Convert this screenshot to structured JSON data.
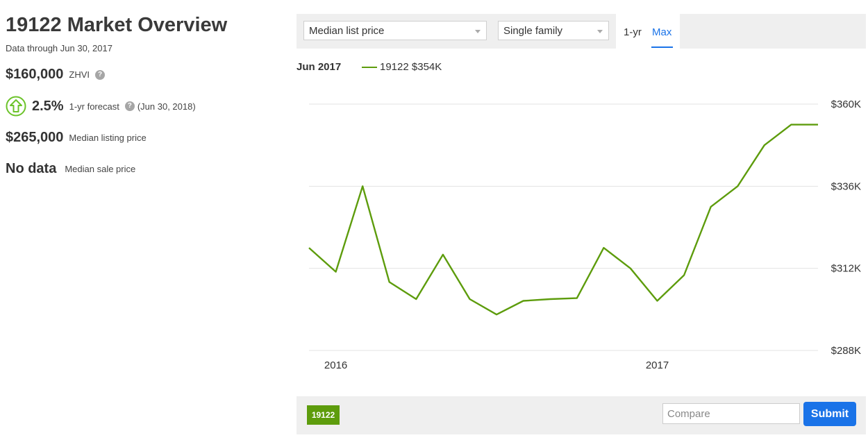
{
  "overview": {
    "title": "19122 Market Overview",
    "data_through": "Data through Jun 30, 2017",
    "zhvi_value": "$160,000",
    "zhvi_label": "ZHVI",
    "help_glyph": "?",
    "forecast_value": "2.5%",
    "forecast_label": "1-yr forecast",
    "forecast_date": "(Jun 30, 2018)",
    "listing_value": "$265,000",
    "listing_label": "Median listing price",
    "sale_value": "No data",
    "sale_label": "Median sale price"
  },
  "toolbar": {
    "metric_select": "Median list price",
    "home_type_select": "Single family",
    "range_1yr": "1-yr",
    "range_max": "Max",
    "active_range": "Max"
  },
  "legend": {
    "date": "Jun 2017",
    "series_label": "19122 $354K"
  },
  "colors": {
    "series": "#5d9c0c",
    "accent": "#1a73e8",
    "forecast_up": "#6cc32a"
  },
  "icons": {
    "help": "question-circle-icon",
    "forecast": "arrow-up-circle-icon",
    "dropdown": "caret-down-icon"
  },
  "bottom": {
    "region_tag": "19122",
    "compare_placeholder": "Compare",
    "submit_label": "Submit"
  },
  "chart_data": {
    "type": "line",
    "x": [
      "2015-09",
      "2015-10",
      "2015-11",
      "2015-12",
      "2016-01",
      "2016-02",
      "2016-03",
      "2016-04",
      "2016-05",
      "2016-06",
      "2016-07",
      "2016-08",
      "2016-09",
      "2016-10",
      "2016-11",
      "2016-12",
      "2017-01",
      "2017-02",
      "2017-03",
      "2017-04",
      "2017-05",
      "2017-06"
    ],
    "series": [
      {
        "name": "19122",
        "values": [
          318000,
          311000,
          336000,
          308000,
          303000,
          316000,
          303000,
          298500,
          302500,
          303000,
          303300,
          318000,
          312000,
          302500,
          310000,
          330000,
          336000,
          348000,
          354000,
          354000
        ]
      }
    ],
    "x_ticks": [
      "2016",
      "2017"
    ],
    "y_ticks": [
      "$288K",
      "$312K",
      "$336K",
      "$360K"
    ],
    "ylim": [
      288000,
      360000
    ],
    "grid": true
  }
}
